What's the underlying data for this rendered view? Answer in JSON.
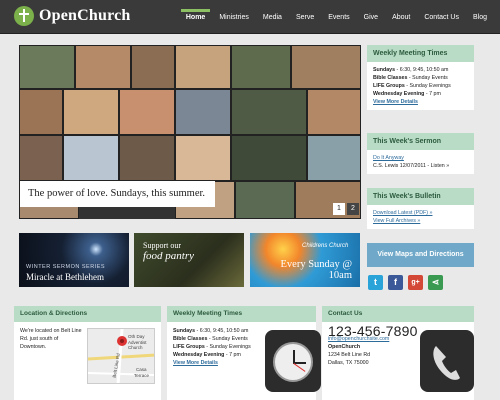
{
  "header": {
    "site_name": "OpenChurch",
    "nav": [
      "Home",
      "Ministries",
      "Media",
      "Serve",
      "Events",
      "Give",
      "About",
      "Contact Us",
      "Blog"
    ],
    "active_nav": "Home"
  },
  "hero": {
    "caption": "The power of love. Sundays, this summer.",
    "pager": [
      "1",
      "2"
    ]
  },
  "sidebar": {
    "meeting": {
      "title": "Weekly Meeting Times",
      "lines": [
        {
          "label": "Sundays",
          "text": " - 6:30, 9:45, 10:50 am"
        },
        {
          "label": "Bible Classes",
          "text": " - Sunday Events"
        },
        {
          "label": "LIFE Groups",
          "text": " - Sunday Evenings"
        },
        {
          "label": "Wednesday Evening",
          "text": " - 7 pm"
        }
      ],
      "link": "View More Details"
    },
    "sermon": {
      "title": "This Week's Sermon",
      "link": "Do It Anyway",
      "meta": "C.S. Lewis 12/07/2011 - Listen »"
    },
    "bulletin": {
      "title": "This Week's Bulletin",
      "link1": "Download Latest (PDF) »",
      "link2": "View Full Archives »"
    },
    "maps_button": "View Maps and Directions",
    "social": [
      {
        "icon": "twitter-icon",
        "glyph": "t",
        "color": "#2aa3d8"
      },
      {
        "icon": "facebook-icon",
        "glyph": "f",
        "color": "#3b5998"
      },
      {
        "icon": "google-plus-icon",
        "glyph": "g+",
        "color": "#d34836"
      },
      {
        "icon": "share-icon",
        "glyph": "⋖",
        "color": "#3a9a52"
      }
    ]
  },
  "promos": {
    "winter": {
      "line1": "WINTER SERMON SERIES",
      "line2": "Miracle at Bethlehem"
    },
    "pantry": {
      "line1": "Support our",
      "line2": "food pantry"
    },
    "children": {
      "line1": "Childrens Church",
      "line2": "Every Sunday @ 10am"
    }
  },
  "bottom": {
    "location": {
      "title": "Location & Directions",
      "text": "We're located on Belt Line Rd. just south of Downtown.",
      "map_labels": [
        "Oth Day",
        "Adventist Church",
        "Casa",
        "Terrace",
        "Belt Line Rd"
      ]
    },
    "meeting": {
      "title": "Weekly Meeting Times",
      "lines": [
        {
          "label": "Sundays",
          "text": " - 6:30, 9:45, 10:50 am"
        },
        {
          "label": "Bible Classes",
          "text": " - Sunday Events"
        },
        {
          "label": "LIFE Groups",
          "text": " - Sunday Evenings"
        },
        {
          "label": "Wednesday Evening",
          "text": " - 7 pm"
        }
      ],
      "link": "View More Details"
    },
    "contact": {
      "title": "Contact Us",
      "phone": "123-456-7890",
      "email": "info@openchurchsite.com",
      "org": "OpenChurch",
      "address": "1234 Belt Line Rd",
      "city": "Dallas, TX 75000"
    }
  },
  "colors": {
    "nav_bg": "#3a3a3a",
    "accent_green": "#8cc063",
    "side_header": "#b9dcc6",
    "maps_btn": "#6fa8c8"
  }
}
